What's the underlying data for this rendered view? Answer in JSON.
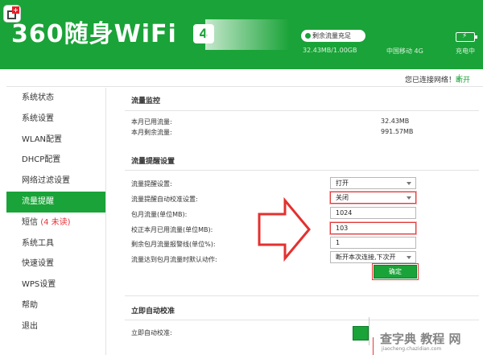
{
  "header": {
    "brand": "360随身WiFi",
    "brand_badge": "4",
    "flow_pill": "剩余流量充足",
    "usage": "32.43MB/1.00GB",
    "carrier": "中国移动 4G",
    "charging": "充电中",
    "accent_color": "#1aa338"
  },
  "statusbar": {
    "connected": "您已连接网络！",
    "separator": "|",
    "disconnect": "断开"
  },
  "sidebar": {
    "items": [
      {
        "label": "系统状态"
      },
      {
        "label": "系统设置"
      },
      {
        "label": "WLAN配置"
      },
      {
        "label": "DHCP配置"
      },
      {
        "label": "网络过滤设置"
      },
      {
        "label": "流量提醒",
        "active": true
      },
      {
        "label": "短信",
        "suffix": "(4 未读)"
      },
      {
        "label": "系统工具"
      },
      {
        "label": "快速设置"
      },
      {
        "label": "WPS设置"
      },
      {
        "label": "帮助"
      },
      {
        "label": "退出"
      }
    ]
  },
  "monitor": {
    "title": "流量监控",
    "used_label": "本月已用流量:",
    "used_value": "32.43MB",
    "remain_label": "本月剩余流量:",
    "remain_value": "991.57MB"
  },
  "reminder": {
    "title": "流量提醒设置",
    "rows": [
      {
        "label": "流量提醒设置:",
        "value": "打开",
        "type": "select"
      },
      {
        "label": "流量提醒自动校准设置:",
        "value": "关闭",
        "type": "select",
        "highlight": true
      },
      {
        "label": "包月流量(单位MB):",
        "value": "1024",
        "type": "text"
      },
      {
        "label": "校正本月已用流量(单位MB):",
        "value": "103",
        "type": "text",
        "highlight": true
      },
      {
        "label": "剩余包月流量报警线(单位%):",
        "value": "1",
        "type": "text"
      },
      {
        "label": "流量达到包月流量时默认动作:",
        "value": "断开本次连接,下次开",
        "type": "select"
      }
    ],
    "confirm": "确定"
  },
  "autocal": {
    "title": "立即自动校准",
    "label": "立即自动校准:"
  },
  "watermark": {
    "main": "查字典 教程 网",
    "sub": "jiaocheng.chazidian.com"
  }
}
